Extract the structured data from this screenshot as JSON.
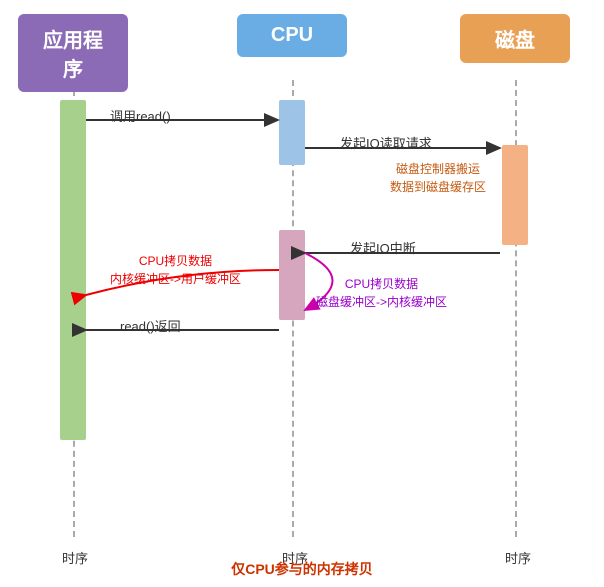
{
  "headers": {
    "app": "应用程序",
    "cpu": "CPU",
    "disk": "磁盘"
  },
  "arrows": {
    "call_read": "调用read()",
    "io_read_request": "发起IO读取请求",
    "disk_controller_note": "磁盘控制器搬运\n数据到磁盘缓存区",
    "io_interrupt": "发起IO中断",
    "cpu_copy_kernel": "CPU拷贝数据\n内核缓冲区->用户缓冲区",
    "cpu_copy_disk": "CPU拷贝数据\n磁盘缓冲区->内核缓冲区",
    "read_return": "read()返回"
  },
  "bottom": {
    "timeline1": "时序",
    "timeline2": "时序",
    "timeline3": "时序",
    "footer": "仅CPU参与的内存拷贝"
  }
}
